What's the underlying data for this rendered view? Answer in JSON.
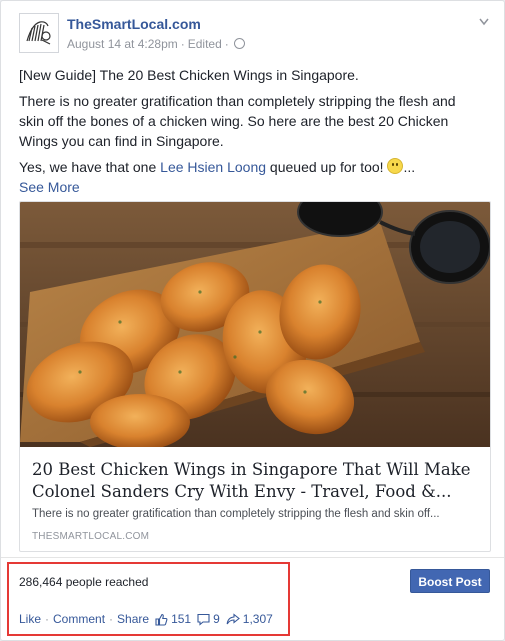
{
  "post": {
    "page_name": "TheSmartLocal.com",
    "date": "August 14 at 4:28pm",
    "edited": "Edited",
    "text": {
      "line1": "[New Guide] The 20 Best Chicken Wings in Singapore.",
      "line2": "There is no greater gratification than completely stripping the flesh and skin off the bones of a chicken wing. So here are the best 20 Chicken Wings you can find in Singapore.",
      "line3_prefix": "Yes, we have that one ",
      "line3_link": "Lee Hsien Loong",
      "line3_suffix": " queued up for too! ",
      "line3_ellipsis": "...",
      "see_more": "See More"
    },
    "attachment": {
      "title": "20 Best Chicken Wings in Singapore That Will Make Colonel Sanders Cry With Envy - Travel, Food &...",
      "description": "There is no greater gratification than completely stripping the flesh and skin off...",
      "domain": "THESMARTLOCAL.COM"
    },
    "reach": "286,464 people reached",
    "boost_label": "Boost Post",
    "actions": {
      "like": "Like",
      "comment": "Comment",
      "share": "Share",
      "likes_count": "151",
      "comments_count": "9",
      "shares_count": "1,307"
    }
  },
  "icons": {
    "avatar": "avatar-icon",
    "globe": "globe-icon",
    "chevron": "chevron-down-icon",
    "like": "thumbs-up-icon",
    "comment": "comment-icon",
    "share": "share-arrow-icon",
    "emoji": "smiley-icon"
  },
  "colors": {
    "link": "#365899",
    "boost_bg": "#4267b2",
    "highlight": "#e53935"
  }
}
